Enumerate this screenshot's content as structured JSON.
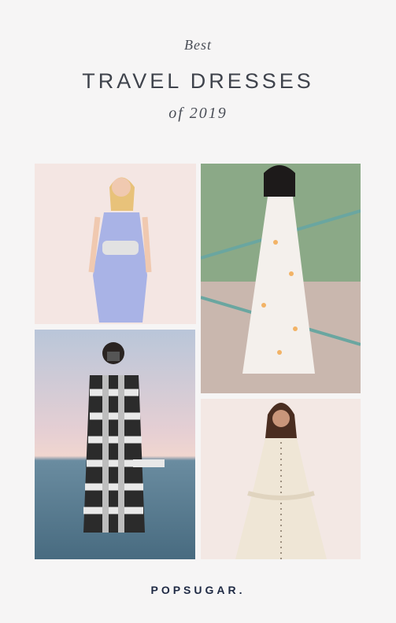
{
  "header": {
    "best": "Best",
    "title": "TRAVEL DRESSES",
    "subtitle": "of 2019"
  },
  "photos": [
    {
      "subject": "woman in lavender printed slip dress with belt bag"
    },
    {
      "subject": "woman in white dress with orange print on stairs"
    },
    {
      "subject": "woman in black and white gingham dress with camera by the sea"
    },
    {
      "subject": "woman in cream ruffled button-front dress"
    }
  ],
  "footer": {
    "brand": "POPSUGAR."
  }
}
